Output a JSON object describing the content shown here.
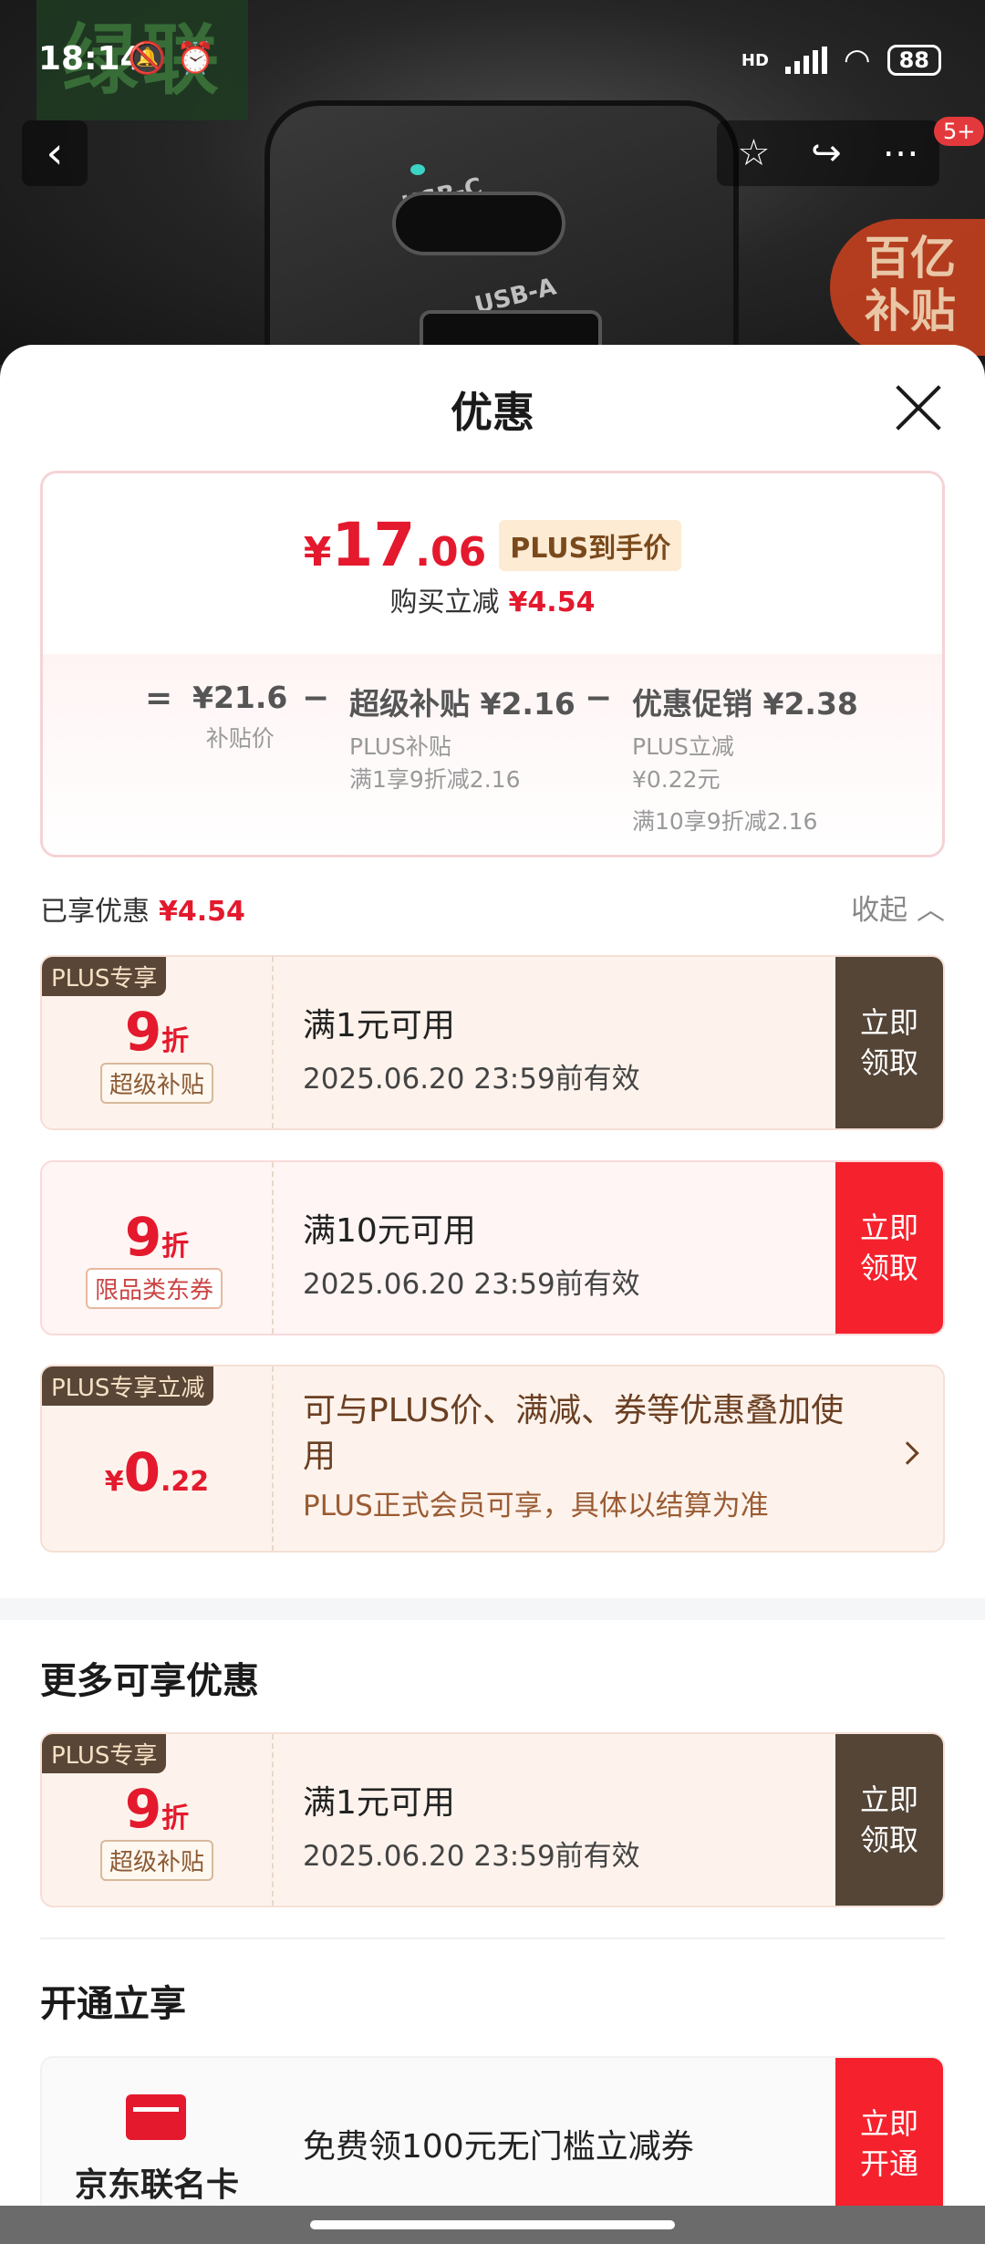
{
  "status": {
    "time": "18:14",
    "left_icons": "🔕 ⏰",
    "network": "HD",
    "battery": "88"
  },
  "hero": {
    "logo_text": "绿联",
    "port_c": "USB-C",
    "port_a": "USB-A",
    "badge_line1": "百亿",
    "badge_line2": "补贴",
    "msg_count": "5+"
  },
  "sheet": {
    "title": "优惠",
    "summary": {
      "price_yen": "¥",
      "price_int": "17",
      "price_dec": ".06",
      "plus_tag": "PLUS到手价",
      "reduce_label": "购买立减",
      "reduce_value": "¥4.54",
      "calc": {
        "eq": "=",
        "minus": "−",
        "base_main": "¥21.6",
        "base_sub": "补贴价",
        "sub1_main": "超级补贴 ¥2.16",
        "sub1_l1": "PLUS补贴",
        "sub1_l2": "满1享9折减2.16",
        "sub2_main": "优惠促销 ¥2.38",
        "sub2_l1": "PLUS立减",
        "sub2_l2": "¥0.22元",
        "sub2_l3": "满10享9折减2.16"
      }
    },
    "enjoyed_label": "已享优惠",
    "enjoyed_value": "¥4.54",
    "collapse_label": "收起",
    "coupons": [
      {
        "corner": "PLUS专享",
        "disc_num": "9",
        "disc_unit": "折",
        "tag": "超级补贴",
        "cond": "满1元可用",
        "expire": "2025.06.20 23:59前有效",
        "cta": "立即领取"
      },
      {
        "disc_num": "9",
        "disc_unit": "折",
        "tag": "限品类东券",
        "cond": "满10元可用",
        "expire": "2025.06.20 23:59前有效",
        "cta": "立即领取"
      }
    ],
    "plus_cut": {
      "corner": "PLUS专享立减",
      "yen": "¥",
      "int": "0",
      "dec": ".22",
      "desc": "可与PLUS价、满减、券等优惠叠加使用",
      "note": "PLUS正式会员可享，具体以结算为准"
    },
    "more_title": "更多可享优惠",
    "more_coupon": {
      "corner": "PLUS专享",
      "disc_num": "9",
      "disc_unit": "折",
      "tag": "超级补贴",
      "cond": "满1元可用",
      "expire": "2025.06.20 23:59前有效",
      "cta": "立即领取"
    },
    "open_title": "开通立享",
    "card_promo": {
      "name": "京东联名卡",
      "desc": "免费领100元无门槛立减券",
      "cta": "立即开通"
    }
  }
}
